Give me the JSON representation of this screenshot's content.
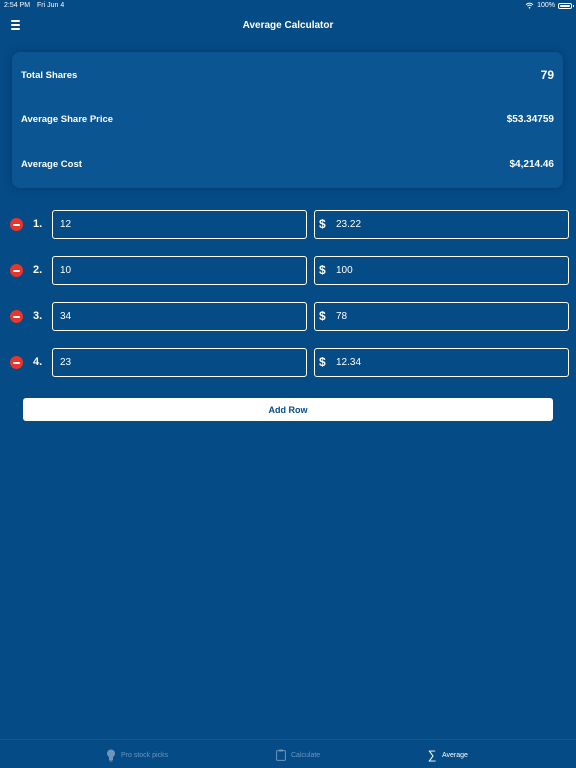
{
  "status_bar": {
    "time": "2:54 PM",
    "date": "Fri Jun 4",
    "battery": "100%"
  },
  "nav": {
    "title": "Average Calculator"
  },
  "summary": {
    "rows": [
      {
        "label": "Total Shares",
        "value": "79"
      },
      {
        "label": "Average Share Price",
        "value": "$53.34759"
      },
      {
        "label": "Average Cost",
        "value": "$4,214.46"
      }
    ]
  },
  "entries": [
    {
      "index": "1.",
      "shares": "12",
      "currency": "$",
      "price": "23.22"
    },
    {
      "index": "2.",
      "shares": "10",
      "currency": "$",
      "price": "100"
    },
    {
      "index": "3.",
      "shares": "34",
      "currency": "$",
      "price": "78"
    },
    {
      "index": "4.",
      "shares": "23",
      "currency": "$",
      "price": "12.34"
    }
  ],
  "add_row_label": "Add Row",
  "tabs": [
    {
      "label": "Pro stock picks",
      "icon": "lightbulb-icon",
      "active": false
    },
    {
      "label": "Calculate",
      "icon": "clipboard-icon",
      "active": false
    },
    {
      "label": "Average",
      "icon": "sigma-icon",
      "active": true
    }
  ],
  "colors": {
    "background": "#054B86",
    "card": "#0B5592",
    "remove": "#E8362C",
    "inactive_tab": "#6F95BB"
  }
}
